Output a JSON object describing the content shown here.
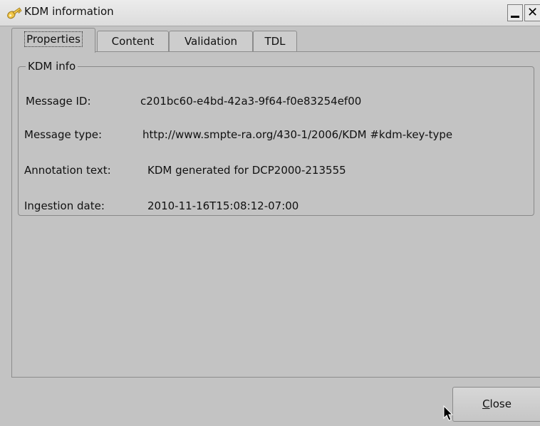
{
  "window": {
    "title": "KDM information",
    "icon": "key-icon",
    "controls": [
      "minimize-icon",
      "close-icon"
    ]
  },
  "tabs": [
    {
      "label": "Properties",
      "active": true
    },
    {
      "label": "Content",
      "active": false
    },
    {
      "label": "Validation",
      "active": false
    },
    {
      "label": "TDL",
      "active": false
    }
  ],
  "kdm_info": {
    "title": "KDM info",
    "rows": [
      {
        "label": "Message ID:",
        "value": "c201bc60-e4bd-42a3-9f64-f0e83254ef00"
      },
      {
        "label": "Message type:",
        "value": "http://www.smpte-ra.org/430-1/2006/KDM #kdm-key-type"
      },
      {
        "label": "Annotation text:",
        "value": "KDM generated for DCP2000-213555"
      },
      {
        "label": "Ingestion date:",
        "value": "2010-11-16T15:08:12-07:00"
      }
    ]
  },
  "buttons": {
    "close_mnemonic": "C",
    "close_rest": "lose"
  },
  "colors": {
    "window_bg": "#c3c3c3",
    "titlebar_bg": "#e4e4e4",
    "border": "#8c8c8c",
    "key_icon": "#f0c040"
  }
}
